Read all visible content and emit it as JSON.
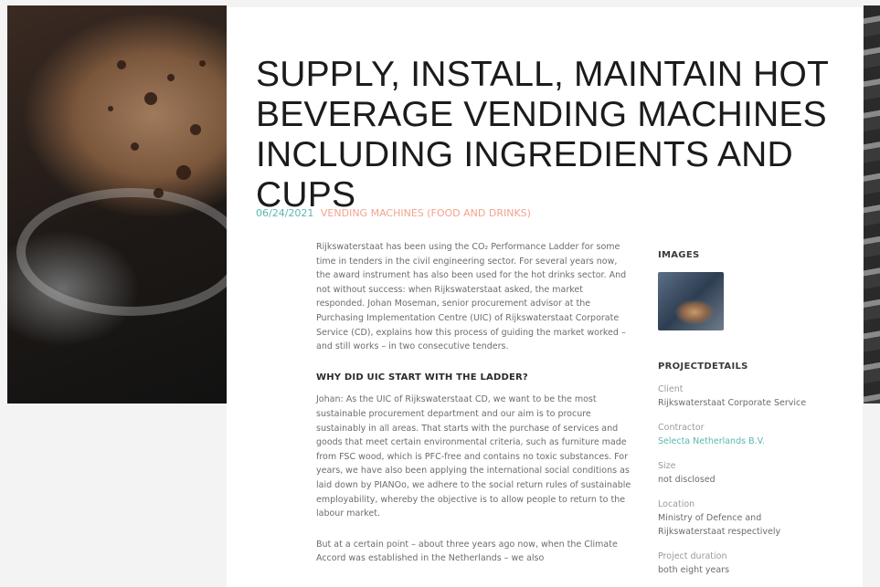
{
  "post": {
    "title": "SUPPLY, INSTALL, MAINTAIN HOT BEVERAGE VENDING MACHINES INCLUDING INGREDIENTS AND CUPS",
    "date": "06/24/2021",
    "category": "VENDING MACHINES (FOOD AND DRINKS)"
  },
  "article": {
    "intro": "Rijkswaterstaat has been using the CO₂ Performance Ladder for some time in tenders in the civil engineering sector. For several years now, the award instrument has also been used for the hot drinks sector. And not without success: when Rijkswaterstaat asked, the market responded. Johan Moseman, senior procurement advisor at the Purchasing Implementation Centre (UIC) of Rijkswaterstaat Corporate Service (CD), explains how this process of guiding the market worked – and still works – in two consecutive tenders.",
    "heading": "WHY DID UIC START WITH THE LADDER?",
    "para1": "Johan: As the UIC of Rijkswaterstaat CD, we want to be the most sustainable procurement department and our aim is to procure sustainably in all areas. That starts with the purchase of services and goods that meet certain environmental criteria, such as furniture made from FSC wood, which is PFC-free and contains no toxic substances. For years, we have also been applying the international social conditions as laid down by PIANOo, we adhere to the social return rules of sustainable employability, whereby the objective is to allow people to return to the labour market.",
    "para2": "But at a certain point – about three years ago now, when the Climate Accord was established in the Netherlands – we also"
  },
  "sidebar": {
    "images_heading": "IMAGES",
    "details_heading": "PROJECTDETAILS",
    "details": [
      {
        "label": "Client",
        "value": "Rijkswaterstaat Corporate Service"
      },
      {
        "label": "Contractor",
        "value": "Selecta Netherlands B.V."
      },
      {
        "label": "Size",
        "value": "not disclosed"
      },
      {
        "label": "Location",
        "value": "Ministry of Defence and Rijkswaterstaat respectively"
      },
      {
        "label": "Project duration",
        "value": "both eight years"
      }
    ]
  },
  "colors": {
    "accent_teal": "#59b7b3",
    "accent_salmon": "#f2a38f",
    "title": "#1b1b1b"
  }
}
